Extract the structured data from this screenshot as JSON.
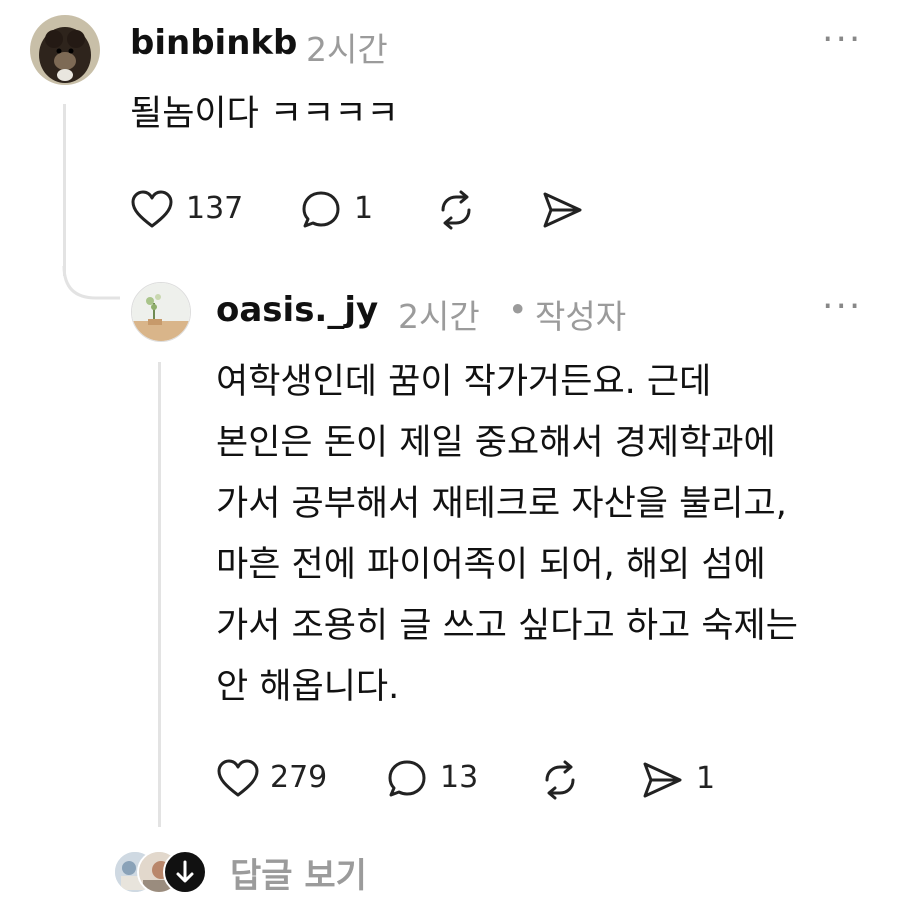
{
  "comments": [
    {
      "username": "binbinkb",
      "time": "2시간",
      "body": "될놈이다 ㅋㅋㅋㅋ",
      "actions": {
        "likes": "137",
        "replies": "1"
      }
    },
    {
      "username": "oasis._jy",
      "time": "2시간",
      "separator": "•",
      "author_badge": "작성자",
      "body_lines": [
        "여학생인데 꿈이 작가거든요. 근데",
        "본인은 돈이 제일 중요해서 경제학과에",
        "가서 공부해서 재테크로 자산을 불리고,",
        "마흔 전에 파이어족이 되어, 해외 섬에",
        "가서 조용히 글 쓰고 싶다고 하고 숙제는",
        "안 해옵니다."
      ],
      "actions": {
        "likes": "279",
        "replies": "13",
        "shares": "1"
      }
    }
  ],
  "view_replies_label": "답글 보기",
  "more_label": "···",
  "colors": {
    "text": "#111111",
    "muted": "#9b9b9b",
    "line": "#e3e3e3"
  }
}
